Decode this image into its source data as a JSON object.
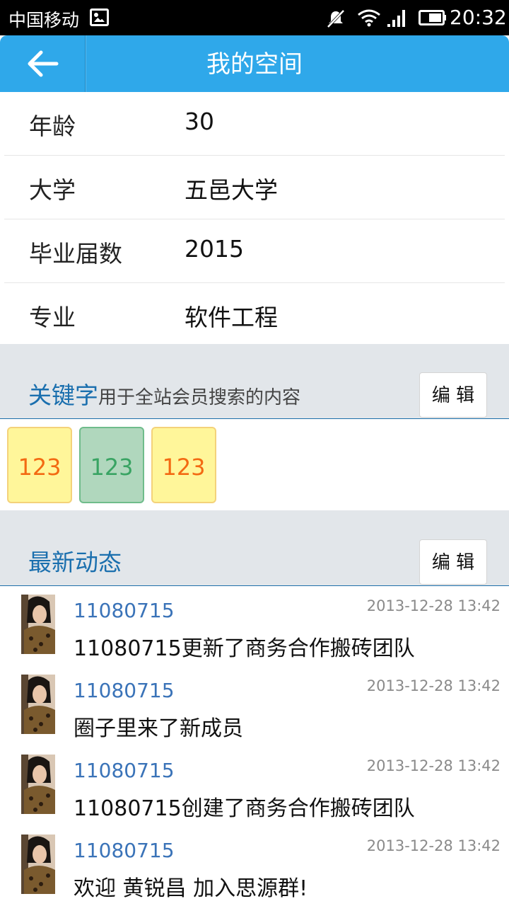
{
  "status_bar": {
    "carrier": "中国移动",
    "time": "20:32"
  },
  "header": {
    "title": "我的空间",
    "back_icon": "arrow-left-icon"
  },
  "profile": [
    {
      "label": "年龄",
      "value": "30"
    },
    {
      "label": "大学",
      "value": "五邑大学"
    },
    {
      "label": "毕业届数",
      "value": "2015"
    },
    {
      "label": "专业",
      "value": "软件工程"
    }
  ],
  "keywords_section": {
    "title": "关键字",
    "subtitle": "用于全站会员搜索的内容",
    "edit_label": "编 辑",
    "tags": [
      "123",
      "123",
      "123"
    ]
  },
  "feed_section": {
    "title": "最新动态",
    "edit_label": "编 辑",
    "items": [
      {
        "user": "11080715",
        "time": "2013-12-28 13:42",
        "text": "11080715更新了商务合作搬砖团队"
      },
      {
        "user": "11080715",
        "time": "2013-12-28 13:42",
        "text": "圈子里来了新成员"
      },
      {
        "user": "11080715",
        "time": "2013-12-28 13:42",
        "text": "11080715创建了商务合作搬砖团队"
      },
      {
        "user": "11080715",
        "time": "2013-12-28 13:42",
        "text": "欢迎 黄锐昌 加入思源群!"
      }
    ]
  },
  "colors": {
    "accent": "#2fa8ea",
    "section_bg": "#e2e6ea",
    "link": "#3a73b8",
    "tag_yellow": "#fff69a",
    "tag_green": "#b0d7bd"
  }
}
